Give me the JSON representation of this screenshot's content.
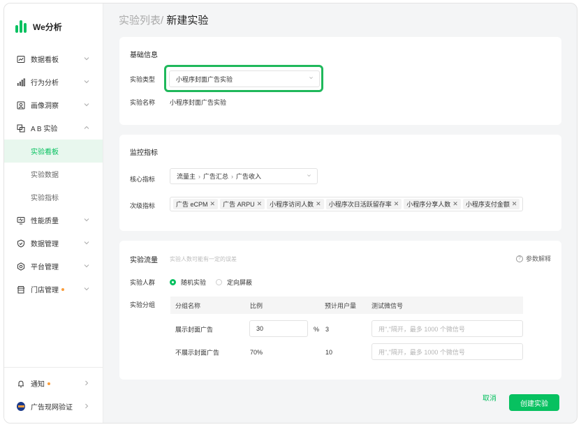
{
  "app": {
    "name": "We分析"
  },
  "sidebar": {
    "items": [
      {
        "label": "数据看板",
        "icon": "chart-board-icon"
      },
      {
        "label": "行为分析",
        "icon": "bar-chart-icon"
      },
      {
        "label": "画像洞察",
        "icon": "user-card-icon"
      },
      {
        "label": "A B 实验",
        "icon": "ab-test-icon"
      },
      {
        "label": "性能质量",
        "icon": "monitor-icon"
      },
      {
        "label": "数据管理",
        "icon": "shield-icon"
      },
      {
        "label": "平台管理",
        "icon": "settings-icon"
      },
      {
        "label": "门店管理",
        "icon": "store-icon"
      }
    ],
    "ab_sub": [
      "实验看板",
      "实验数据",
      "实验指标"
    ],
    "active_sub": "实验看板",
    "bottom": [
      {
        "label": "通知",
        "icon": "bell-icon"
      },
      {
        "label": "广告现网验证",
        "icon": "avatar"
      }
    ]
  },
  "breadcrumb": {
    "parent": "实验列表/",
    "current": "新建实验"
  },
  "basic": {
    "title": "基础信息",
    "type_label": "实验类型",
    "type_value": "小程序封面广告实验",
    "name_label": "实验名称",
    "name_value": "小程序封面广告实验"
  },
  "metrics": {
    "title": "监控指标",
    "core_label": "核心指标",
    "core_path": [
      "流量主",
      "广告汇总",
      "广告收入"
    ],
    "secondary_label": "次级指标",
    "secondary_tags": [
      "广告 eCPM",
      "广告 ARPU",
      "小程序访问人数",
      "小程序次日活跃留存率",
      "小程序分享人数",
      "小程序支付金额"
    ]
  },
  "traffic": {
    "title": "实验流量",
    "hint": "实验人数可能有一定的误差",
    "help": "参数解释",
    "crowd_label": "实验人群",
    "options": [
      "随机实验",
      "定向屏蔽"
    ],
    "group_label": "实验分组",
    "columns": [
      "分组名称",
      "比例",
      "预计用户量",
      "测试微信号"
    ],
    "rows": [
      {
        "name": "展示封面广告",
        "ratio": "30",
        "unit": "%",
        "users": "3",
        "wechat_placeholder": "用\",\"隔开，最多 1000 个微信号"
      },
      {
        "name": "不展示封面广告",
        "ratio": "70%",
        "users": "10",
        "wechat_placeholder": "用\",\"隔开，最多 1000 个微信号"
      }
    ]
  },
  "actions": {
    "cancel": "取消",
    "create": "创建实验"
  },
  "colors": {
    "accent": "#07c160",
    "highlight": "#1fb85b",
    "dot": "#fa9d3b"
  }
}
